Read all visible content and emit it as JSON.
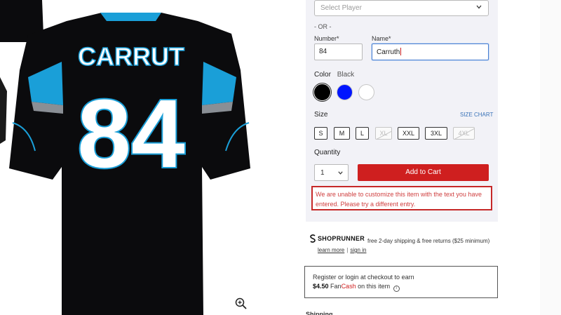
{
  "product": {
    "jersey_name": "CARRUT",
    "jersey_number": "84",
    "colors": {
      "jersey_body": "#0b0b0d",
      "accent_blue": "#1a9fd8",
      "number_fill": "#ffffff",
      "number_outline": "#1a9fd8"
    }
  },
  "form": {
    "select_player_placeholder": "Select Player",
    "or_label": "- OR -",
    "number_label": "Number*",
    "name_label": "Name*",
    "number_value": "84",
    "name_value": "Carruth",
    "color_label": "Color",
    "color_value": "Black",
    "swatches": [
      {
        "name": "black",
        "hex": "#000000"
      },
      {
        "name": "blue",
        "hex": "#0015ff"
      },
      {
        "name": "white",
        "hex": "#ffffff"
      }
    ],
    "size_label": "Size",
    "size_chart_label": "SIZE CHART",
    "sizes": [
      "S",
      "M",
      "L",
      "XL",
      "XXL",
      "3XL",
      "4XL"
    ],
    "disabled_sizes": [
      "XL",
      "4XL"
    ],
    "quantity_label": "Quantity",
    "quantity_value": "1",
    "add_to_cart_label": "Add to Cart",
    "error_message": "We are unable to customize this item with the text you have entered. Please try a different entry."
  },
  "shoprunner": {
    "logo_text": "SHOPRUNNER",
    "description": "free 2-day shipping & free returns ($25 minimum)",
    "learn_more": "learn more",
    "sign_in": "sign in"
  },
  "fancash": {
    "line1": "Register or login at checkout to earn",
    "amount": "$4.50",
    "fan": "Fan",
    "cash": "Cash",
    "suffix": "on this item"
  },
  "bottom_text": "Shipping"
}
